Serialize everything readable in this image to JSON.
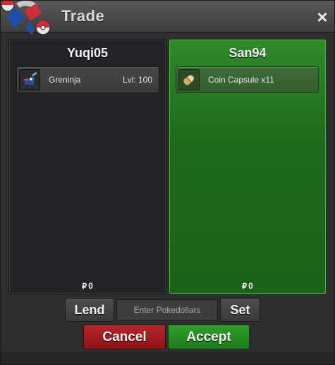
{
  "window": {
    "title": "Trade",
    "close_symbol": "×"
  },
  "left_panel": {
    "player": "Yuqi05",
    "item": {
      "icon": "greninja-sprite-icon",
      "name": "Greninja",
      "level": "Lvl: 100"
    },
    "money": "0",
    "money_symbol": "₽"
  },
  "right_panel": {
    "player": "San94",
    "item": {
      "icon": "coin-capsule-icon",
      "name": "Coin Capsule  x11"
    },
    "money": "0",
    "money_symbol": "₽"
  },
  "controls": {
    "lend_label": "Lend",
    "pokedollar_placeholder": "Enter Pokedollars",
    "set_label": "Set",
    "cancel_label": "Cancel",
    "accept_label": "Accept"
  },
  "colors": {
    "accept_green": "#2fa02b",
    "cancel_red": "#b8232a",
    "partner_panel_green": "#2f8a2a"
  }
}
